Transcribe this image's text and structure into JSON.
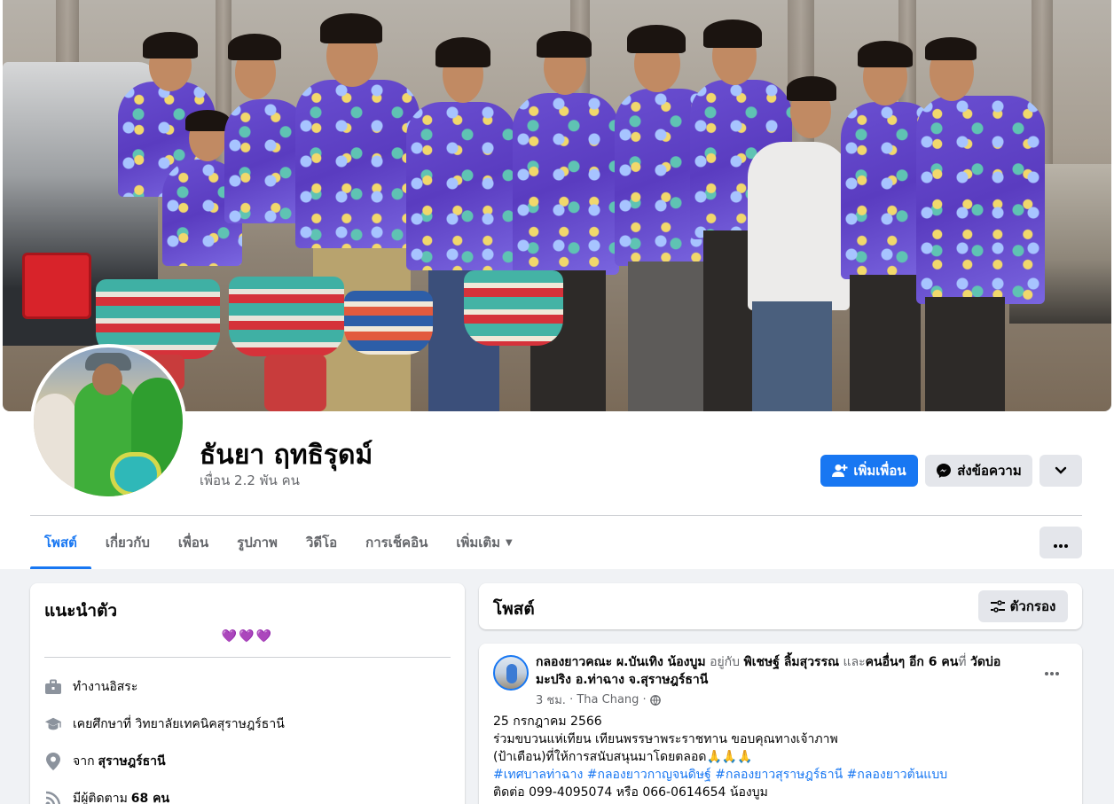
{
  "profile": {
    "name": "ธันยา ฤทธิรุดม์",
    "friends": "เพื่อน 2.2 พัน คน"
  },
  "actions": {
    "add_friend": "เพิ่มเพื่อน",
    "message": "ส่งข้อความ"
  },
  "tabs": [
    {
      "label": "โพสต์"
    },
    {
      "label": "เกี่ยวกับ"
    },
    {
      "label": "เพื่อน"
    },
    {
      "label": "รูปภาพ"
    },
    {
      "label": "วิดีโอ"
    },
    {
      "label": "การเช็คอิน"
    },
    {
      "label": "เพิ่มเติม"
    }
  ],
  "intro": {
    "title": "แนะนำตัว",
    "bio": "💜💜💜",
    "work": "ทำงานอิสระ",
    "education": "เคยศึกษาที่ วิทยาลัยเทคนิคสุราษฎร์ธานี",
    "from_prefix": "จาก",
    "from_place": "สุราษฎร์ธานี",
    "followers_prefix": "มีผู้ติดตาม",
    "followers_count": "68 คน"
  },
  "posts": {
    "title": "โพสต์",
    "filter_label": "ตัวกรอง"
  },
  "post": {
    "author": "กลองยาวคณะ ผ.บันเทิง น้องบูม",
    "with_text": "อยู่กับ",
    "tagged": "พิเชษฐ์ ลิ้มสุวรรณ",
    "and_text": "และ",
    "others": "คนอื่นๆ อีก 6 คน",
    "at_text": "ที่",
    "location": "วัดบ่อมะปริง อ.ท่าฉาง จ.สุราษฎร์ธานี",
    "time": "3 ชม.",
    "place": "Tha Chang",
    "lines": [
      "25 กรกฎาคม 2566",
      "ร่วมขบวนแห่เทียน เทียนพรรษาพระราชทาน ขอบคุณทางเจ้าภาพ",
      "(ป้าเตือน)ที่ให้การสนับสนุนมาโดยตลอด🙏🙏🙏"
    ],
    "hashtags": "#เทศบาลท่าฉาง #กลองยาวกาญจนดิษฐ์ #กลองยาวสุราษฎร์ธานี #กลองยาวต้นแบบ",
    "contact": "ติดต่อ 099-4095074 หรือ 066-0614654 น้องบูม"
  },
  "colors": {
    "accent": "#1877f2",
    "background": "#f0f2f5",
    "secondary_button": "#e4e6eb"
  }
}
